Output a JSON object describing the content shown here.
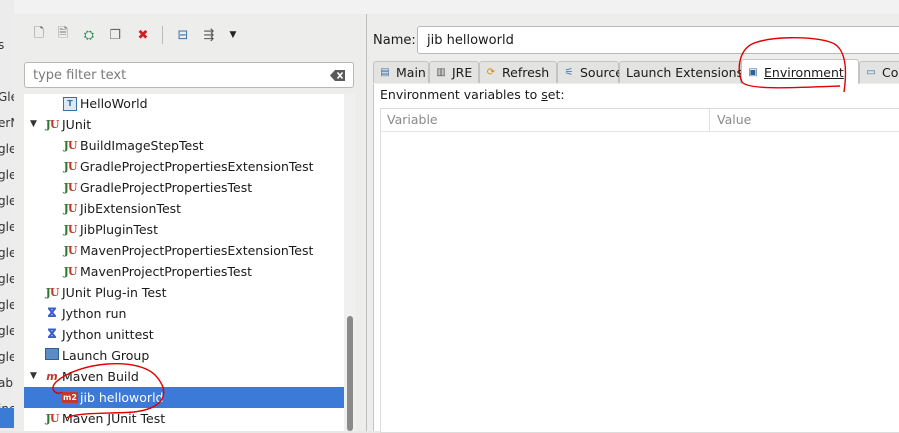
{
  "background_window": {
    "strip_texts": [
      "s",
      "",
      "Gle",
      "erN",
      "gle",
      "gle",
      "gle",
      "gle",
      "gle",
      "gle",
      "gle",
      "gle",
      "gle",
      "abl",
      "inc"
    ]
  },
  "toolbar": {
    "buttons": [
      {
        "name": "new-configuration-icon",
        "glyph": "🗋"
      },
      {
        "name": "new-prototype-icon",
        "glyph": "🗎"
      },
      {
        "name": "export-icon",
        "glyph": "⛭"
      },
      {
        "name": "duplicate-icon",
        "glyph": "❐"
      },
      {
        "name": "delete-icon",
        "glyph": "✖"
      },
      {
        "name": "collapse-all-icon",
        "glyph": "⊟"
      },
      {
        "name": "filter-icon",
        "glyph": "⇶"
      },
      {
        "name": "view-menu-icon",
        "glyph": "▼"
      }
    ]
  },
  "filter": {
    "placeholder": "type filter text"
  },
  "tree": {
    "items": [
      {
        "label": "HelloWorld",
        "indent": 2,
        "icon": "java-app-icon",
        "glyph": "▣"
      },
      {
        "label": "JUnit",
        "indent": 1,
        "icon": "junit-icon",
        "expanded": true
      },
      {
        "label": "BuildImageStepTest",
        "indent": 2,
        "icon": "junit-icon"
      },
      {
        "label": "GradleProjectPropertiesExtensionTest",
        "indent": 2,
        "icon": "junit-icon"
      },
      {
        "label": "GradleProjectPropertiesTest",
        "indent": 2,
        "icon": "junit-icon"
      },
      {
        "label": "JibExtensionTest",
        "indent": 2,
        "icon": "junit-icon"
      },
      {
        "label": "JibPluginTest",
        "indent": 2,
        "icon": "junit-icon"
      },
      {
        "label": "MavenProjectPropertiesExtensionTest",
        "indent": 2,
        "icon": "junit-icon"
      },
      {
        "label": "MavenProjectPropertiesTest",
        "indent": 2,
        "icon": "junit-icon"
      },
      {
        "label": "JUnit Plug-in Test",
        "indent": 1,
        "icon": "junit-plugin-icon"
      },
      {
        "label": "Jython run",
        "indent": 1,
        "icon": "jython-icon"
      },
      {
        "label": "Jython unittest",
        "indent": 1,
        "icon": "jython-unittest-icon"
      },
      {
        "label": "Launch Group",
        "indent": 1,
        "icon": "launch-group-icon"
      },
      {
        "label": "Maven Build",
        "indent": 1,
        "icon": "maven-icon",
        "expanded": true
      },
      {
        "label": "jib helloworld",
        "indent": 2,
        "icon": "maven-config-icon",
        "selected": true
      },
      {
        "label": "Maven JUnit Test",
        "indent": 1,
        "icon": "maven-junit-icon"
      }
    ]
  },
  "config": {
    "name_label": "Name:",
    "name_value": "jib helloworld"
  },
  "tabs": [
    {
      "label": "Main",
      "icon": "main-tab-icon",
      "glyph": "▤"
    },
    {
      "label": "JRE",
      "icon": "jre-tab-icon",
      "glyph": "▥"
    },
    {
      "label": "Refresh",
      "icon": "refresh-tab-icon",
      "glyph": "⟳"
    },
    {
      "label": "Source",
      "icon": "source-tab-icon",
      "glyph": "⚟"
    },
    {
      "label": "Launch Extensions",
      "icon": "",
      "glyph": ""
    },
    {
      "label": "Environment",
      "icon": "environment-tab-icon",
      "glyph": "▣",
      "active": true
    },
    {
      "label": "Co",
      "icon": "common-tab-icon",
      "glyph": "▭"
    }
  ],
  "environment": {
    "label_prefix": "Environment variables to ",
    "label_accel": "s",
    "label_suffix": "et:",
    "columns": [
      "Variable",
      "Value"
    ]
  },
  "colors": {
    "selection": "#3b7ad6",
    "annotation": "#e00000"
  }
}
